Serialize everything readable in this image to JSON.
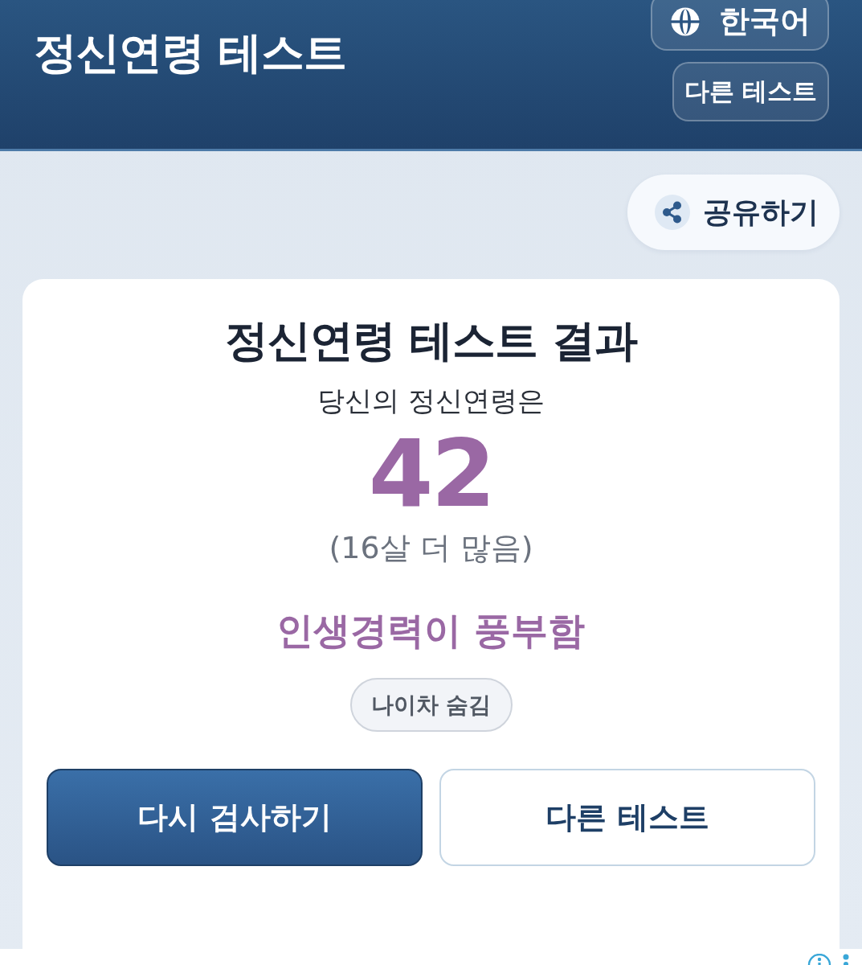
{
  "header": {
    "title": "정신연령 테스트",
    "language_button": {
      "label": "한국어"
    },
    "other_tests_button": {
      "label": "다른 테스트"
    }
  },
  "share_button": {
    "label": "공유하기"
  },
  "result_card": {
    "title": "정신연령 테스트 결과",
    "intro": "당신의 정신연령은",
    "age": "42",
    "age_difference": "(16살 더 많음)",
    "verdict": "인생경력이 풍부함",
    "toggle_button": {
      "label": "나이차 숨김"
    },
    "actions": [
      {
        "label": "다시 검사하기",
        "kind": "primary"
      },
      {
        "label": "다른 테스트",
        "kind": "secondary"
      }
    ]
  }
}
